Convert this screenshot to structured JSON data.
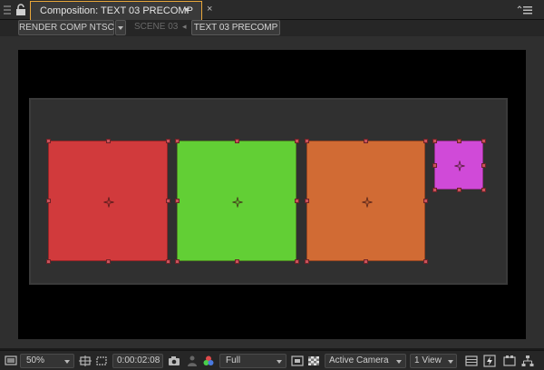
{
  "window": {
    "tab_title": "Composition: TEXT 03 PRECOMP",
    "close_glyph": "×"
  },
  "breadcrumbs": {
    "render_comp": "RENDER COMP NTSC",
    "scene": "SCENE 03",
    "current": "TEXT 03 PRECOMP",
    "separator": "◂"
  },
  "layers": [
    {
      "name": "red-square-layer",
      "color": "#d13a3c"
    },
    {
      "name": "green-square-layer",
      "color": "#62cf35"
    },
    {
      "name": "orange-square-layer",
      "color": "#d16b34"
    },
    {
      "name": "magenta-square-layer",
      "color": "#d04ad8"
    }
  ],
  "toolbar": {
    "zoom": "50%",
    "timecode": "0:00:02:08",
    "resolution": "Full",
    "camera": "Active Camera",
    "view_layout": "1 View"
  },
  "icons": [
    "panel-grip-icon",
    "lock-icon",
    "panel-menu-icon",
    "monitor-icon",
    "region-icon",
    "mask-icon",
    "camera-icon",
    "person-icon",
    "color-channels-icon",
    "roi-icon",
    "transparency-grid-icon",
    "timeline-icon",
    "fast-preview-icon",
    "comp-flowchart-icon",
    "flowchart-icon"
  ],
  "colors": {
    "selection_handle": "#c9525a",
    "active_tab_border": "#e8a63a"
  }
}
